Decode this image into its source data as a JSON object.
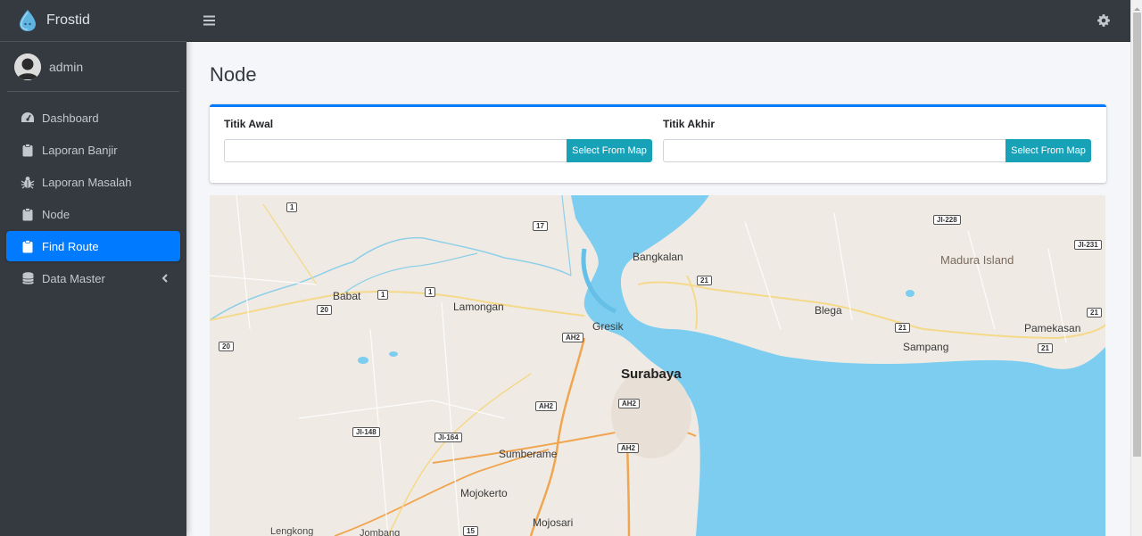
{
  "app": {
    "name": "Frostid"
  },
  "user": {
    "name": "admin"
  },
  "sidebar": {
    "items": [
      {
        "label": "Dashboard",
        "icon": "tachometer-icon",
        "active": false
      },
      {
        "label": "Laporan Banjir",
        "icon": "clipboard-icon",
        "active": false
      },
      {
        "label": "Laporan Masalah",
        "icon": "bug-icon",
        "active": false
      },
      {
        "label": "Node",
        "icon": "clipboard-icon",
        "active": false
      },
      {
        "label": "Find Route",
        "icon": "clipboard-icon",
        "active": true
      },
      {
        "label": "Data Master",
        "icon": "database-icon",
        "active": false,
        "has_submenu": true
      }
    ]
  },
  "page": {
    "title": "Node"
  },
  "form": {
    "start": {
      "label": "Titik Awal",
      "value": "",
      "button": "Select From Map"
    },
    "end": {
      "label": "Titik Akhir",
      "value": "",
      "button": "Select From Map"
    }
  },
  "map": {
    "labels": {
      "bangkalan": "Bangkalan",
      "madura": "Madura Island",
      "babat": "Babat",
      "lamongan": "Lamongan",
      "gresik": "Gresik",
      "blega": "Blega",
      "sampang": "Sampang",
      "pamekasan": "Pamekasan",
      "surabaya": "Surabaya",
      "sumberame": "Sumberame",
      "mojokerto": "Mojokerto",
      "mojosari": "Mojosari",
      "lengkong": "Lengkong",
      "jombang": "Jombang"
    },
    "shields": {
      "s1a": "1",
      "s17": "17",
      "s228": "JI-228",
      "s231": "JI-231",
      "s21a": "21",
      "s1b": "1",
      "s1c": "1",
      "s20a": "20",
      "s21b": "21",
      "s21c": "21",
      "s20b": "20",
      "sah2a": "AH2",
      "s21d": "21",
      "sah2b": "AH2",
      "sah2c": "AH2",
      "s148": "JI-148",
      "s164": "JI-164",
      "sah2d": "AH2",
      "s15": "15"
    },
    "colors": {
      "water": "#7ccdf0",
      "land": "#efebe4",
      "highway": "#f0a550",
      "road": "#f5d98a"
    }
  },
  "colors": {
    "sidebar": "#343a40",
    "accent": "#007bff",
    "button": "#17a2b8"
  }
}
